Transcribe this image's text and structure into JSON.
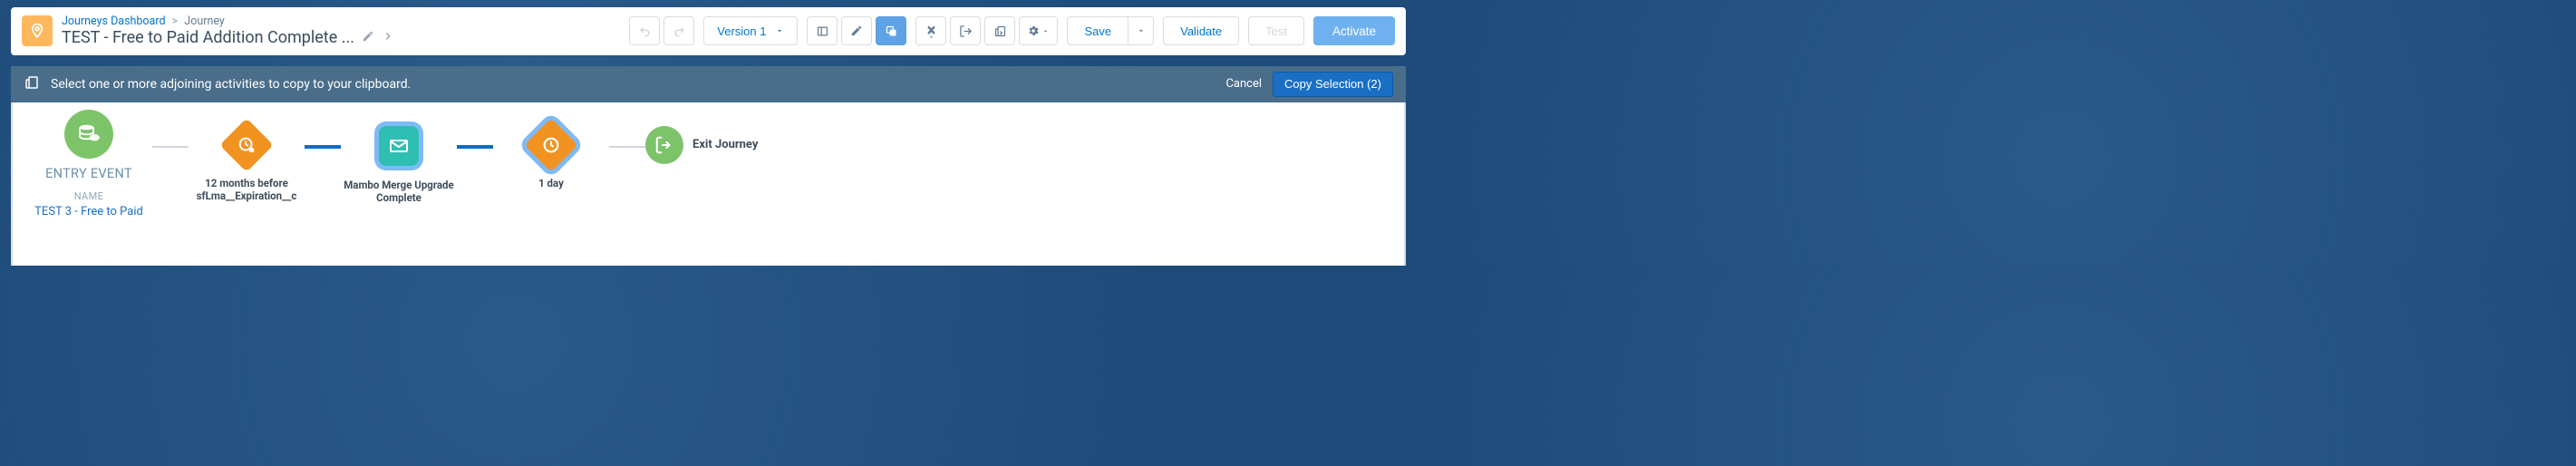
{
  "breadcrumb": {
    "dashboard": "Journeys Dashboard",
    "current": "Journey"
  },
  "journey": {
    "title": "TEST - Free to Paid Addition Complete ..."
  },
  "toolbar": {
    "version_label": "Version 1",
    "save_label": "Save",
    "validate_label": "Validate",
    "test_label": "Test",
    "activate_label": "Activate"
  },
  "instruction": {
    "message": "Select one or more adjoining activities to copy to your clipboard.",
    "cancel_label": "Cancel",
    "copy_label": "Copy Selection (2)"
  },
  "canvas": {
    "entry": {
      "heading": "ENTRY EVENT",
      "name_label": "NAME",
      "name_value": "TEST 3 - Free to Paid"
    },
    "nodes": {
      "wait_expiration": "12 months before sfLma__Expiration__c",
      "email": "Mambo Merge Upgrade Complete",
      "wait_day": "1 day",
      "exit": "Exit Journey"
    }
  },
  "colors": {
    "brand_blue": "#0176d3",
    "bar_blue": "#4a6d8a",
    "button_blue": "#1a6ec4",
    "light_blue": "#6fb1f0",
    "orange": "#f29221",
    "teal": "#2ebfb2",
    "green": "#7cc36a"
  }
}
